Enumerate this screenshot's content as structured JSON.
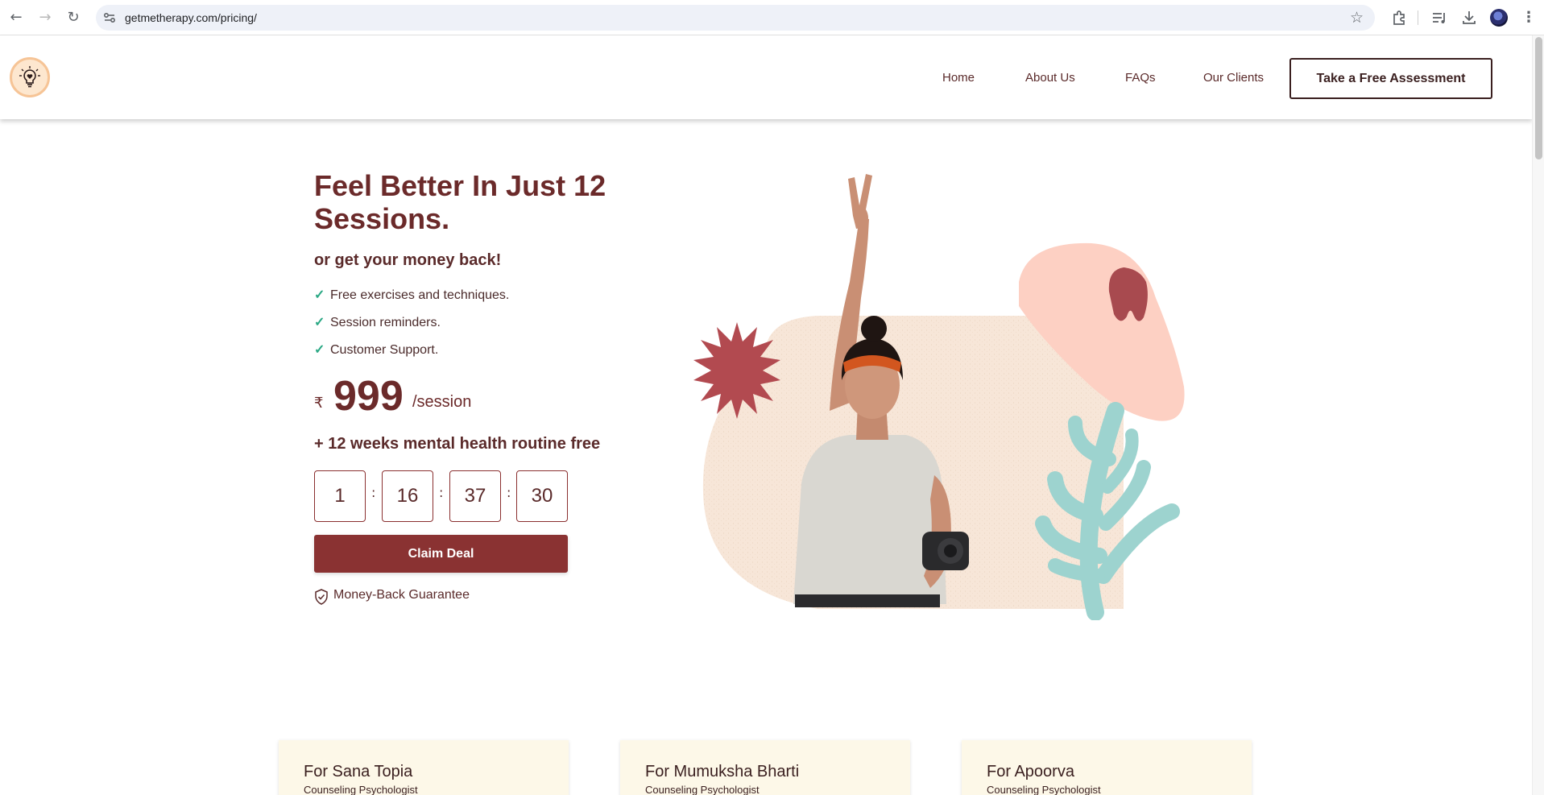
{
  "browser": {
    "url": "getmetherapy.com/pricing/"
  },
  "header": {
    "nav": [
      "Home",
      "About Us",
      "FAQs",
      "Our Clients"
    ],
    "cta_label": "Take a Free Assessment"
  },
  "hero": {
    "headline": "Feel Better In Just 12 Sessions.",
    "subhead": "or get your money back!",
    "features": [
      "Free exercises and techniques.",
      "Session reminders.",
      "Customer Support."
    ],
    "currency": "₹",
    "price": "999",
    "price_unit": "/session",
    "bonus": "+ 12 weeks mental health routine free",
    "countdown": [
      "1",
      "16",
      "37",
      "30"
    ],
    "countdown_separator": ":",
    "claim_label": "Claim Deal",
    "guarantee": "Money-Back Guarantee"
  },
  "cards": [
    {
      "name": "For Sana Topia",
      "role": "Counseling Psychologist"
    },
    {
      "name": "For Mumuksha Bharti",
      "role": "Counseling Psychologist"
    },
    {
      "name": "For Apoorva",
      "role": "Counseling Psychologist"
    }
  ],
  "colors": {
    "brand": "#6b2a2a",
    "button": "#8a3232",
    "check": "#2aa884",
    "card_bg": "#fdf8e8"
  }
}
